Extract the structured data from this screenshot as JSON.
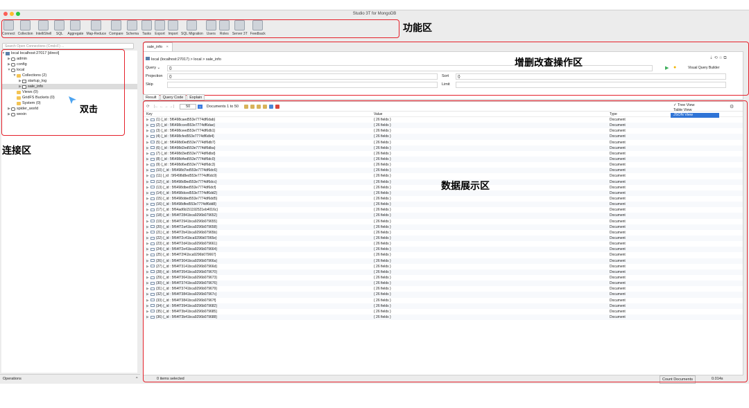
{
  "window": {
    "title": "Studio 3T for MongoDB"
  },
  "toolbar": {
    "items": [
      "Connect",
      "Collection",
      "IntelliShell",
      "SQL",
      "Aggregate",
      "Map-Reduce",
      "Compare",
      "Schema",
      "Tasks",
      "Export",
      "Import",
      "SQL Migration",
      "Users",
      "Roles",
      "Server 3T",
      "Feedback"
    ]
  },
  "annotations": {
    "toolbar": "功能区",
    "query": "增删改查操作区",
    "dblclick": "双击",
    "connection": "连接区",
    "data": "数据展示区"
  },
  "sidebar": {
    "search_placeholder": "Search Open Connections (Cmd+F) ...",
    "tree": [
      {
        "label": "local localhost:27017 [direct]",
        "indent": 0,
        "icon": "server-icon",
        "arrow": "▼"
      },
      {
        "label": "admin",
        "indent": 1,
        "icon": "database-icon",
        "arrow": "▶"
      },
      {
        "label": "config",
        "indent": 1,
        "icon": "database-icon",
        "arrow": "▶"
      },
      {
        "label": "local",
        "indent": 1,
        "icon": "database-icon",
        "arrow": "▼"
      },
      {
        "label": "Collections (2)",
        "indent": 2,
        "icon": "folder-icon",
        "arrow": "▼"
      },
      {
        "label": "startup_log",
        "indent": 3,
        "icon": "collection-icon",
        "arrow": "▶"
      },
      {
        "label": "sale_info",
        "indent": 3,
        "icon": "collection-icon",
        "arrow": "▶",
        "selected": true
      },
      {
        "label": "Views (0)",
        "indent": 2,
        "icon": "folder-icon",
        "arrow": ""
      },
      {
        "label": "GridFS Buckets (0)",
        "indent": 2,
        "icon": "folder-icon",
        "arrow": ""
      },
      {
        "label": "System (0)",
        "indent": 2,
        "icon": "folder-icon",
        "arrow": ""
      },
      {
        "label": "spider_world",
        "indent": 1,
        "icon": "database-icon",
        "arrow": "▶"
      },
      {
        "label": "wexin",
        "indent": 1,
        "icon": "database-icon",
        "arrow": "▶"
      }
    ],
    "operations_label": "Operations"
  },
  "editor": {
    "tab_label": "sale_info",
    "breadcrumb": "local (localhost:27017)  >  local  >  sale_info",
    "query_label": "Query",
    "query_value": "{}",
    "projection_label": "Projection",
    "projection_value": "{}",
    "sort_label": "Sort",
    "sort_value": "{}",
    "skip_label": "Skip",
    "limit_label": "Limit",
    "visual_query_builder": "Visual Query Builder"
  },
  "results": {
    "subtabs": [
      "Result",
      "Query Code",
      "Explain"
    ],
    "page_size": "50",
    "doc_range": "Documents 1 to 50",
    "columns": {
      "key": "Key",
      "value": "Value",
      "type": "Type"
    },
    "view_options": [
      "Tree View",
      "Table View",
      "JSON View"
    ],
    "rows": [
      {
        "key": "(1) {_id : 5f6498caed553e7774df6dab}",
        "value": "{ 26 fields }",
        "type": "Document"
      },
      {
        "key": "(2) {_id : 5f6498cced553e7774df6dae}",
        "value": "{ 26 fields }",
        "type": "Document"
      },
      {
        "key": "(3) {_id : 5f6498ceed553e7774df6db1}",
        "value": "{ 26 fields }",
        "type": "Document"
      },
      {
        "key": "(4) {_id : 5f6498cfed553e7774df6db4}",
        "value": "{ 26 fields }",
        "type": "Document"
      },
      {
        "key": "(5) {_id : 5f6498d0ed553e7774df6db7}",
        "value": "{ 26 fields }",
        "type": "Document"
      },
      {
        "key": "(6) {_id : 5f6498d2ed553e7774df6dba}",
        "value": "{ 26 fields }",
        "type": "Document"
      },
      {
        "key": "(7) {_id : 5f6498d3ed553e7774df6dbd}",
        "value": "{ 26 fields }",
        "type": "Document"
      },
      {
        "key": "(8) {_id : 5f6498d4ed553e7774df6dc0}",
        "value": "{ 26 fields }",
        "type": "Document"
      },
      {
        "key": "(9) {_id : 5f6498d6ed553e7774df6dc3}",
        "value": "{ 26 fields }",
        "type": "Document"
      },
      {
        "key": "(10) {_id : 5f6498d7ed553e7774df6dc6}",
        "value": "{ 26 fields }",
        "type": "Document"
      },
      {
        "key": "(11) {_id : 5f6498d8ed553e7774df6dc9}",
        "value": "{ 26 fields }",
        "type": "Document"
      },
      {
        "key": "(12) {_id : 5f6498d9ed553e7774df6dcc}",
        "value": "{ 26 fields }",
        "type": "Document"
      },
      {
        "key": "(13) {_id : 5f6498dbed553e7774df6dcf}",
        "value": "{ 26 fields }",
        "type": "Document"
      },
      {
        "key": "(14) {_id : 5f6498dced553e7774df6dd2}",
        "value": "{ 26 fields }",
        "type": "Document"
      },
      {
        "key": "(15) {_id : 5f6498dded553e7774df6dd5}",
        "value": "{ 26 fields }",
        "type": "Document"
      },
      {
        "key": "(16) {_id : 5f6498dfed553e7774df6dd8}",
        "value": "{ 26 fields }",
        "type": "Document"
      },
      {
        "key": "(17) {_id : 5f64ad6b151192521eb4016c}",
        "value": "{ 26 fields }",
        "type": "Document"
      },
      {
        "key": "(18) {_id : 5f64f72841bca9296b079652}",
        "value": "{ 26 fields }",
        "type": "Document"
      },
      {
        "key": "(19) {_id : 5f64f72941bca9296b079655}",
        "value": "{ 26 fields }",
        "type": "Document"
      },
      {
        "key": "(20) {_id : 5f64f72a41bca9296b079658}",
        "value": "{ 26 fields }",
        "type": "Document"
      },
      {
        "key": "(21) {_id : 5f64f72b41bca9296b07965b}",
        "value": "{ 26 fields }",
        "type": "Document"
      },
      {
        "key": "(22) {_id : 5f64f72c41bca9296b07965e}",
        "value": "{ 26 fields }",
        "type": "Document"
      },
      {
        "key": "(23) {_id : 5f64f72d41bca9296b079661}",
        "value": "{ 26 fields }",
        "type": "Document"
      },
      {
        "key": "(24) {_id : 5f64f72e41bca9296b079664}",
        "value": "{ 26 fields }",
        "type": "Document"
      },
      {
        "key": "(25) {_id : 5f64f72f41bca9296b079667}",
        "value": "{ 26 fields }",
        "type": "Document"
      },
      {
        "key": "(26) {_id : 5f64f73041bca9296b07966a}",
        "value": "{ 26 fields }",
        "type": "Document"
      },
      {
        "key": "(27) {_id : 5f64f73141bca9296b07966d}",
        "value": "{ 26 fields }",
        "type": "Document"
      },
      {
        "key": "(28) {_id : 5f64f73541bca9296b079670}",
        "value": "{ 26 fields }",
        "type": "Document"
      },
      {
        "key": "(29) {_id : 5f64f73641bca9296b079673}",
        "value": "{ 26 fields }",
        "type": "Document"
      },
      {
        "key": "(30) {_id : 5f64f73741bca9296b079676}",
        "value": "{ 26 fields }",
        "type": "Document"
      },
      {
        "key": "(31) {_id : 5f64f73741bca9296b079679}",
        "value": "{ 26 fields }",
        "type": "Document"
      },
      {
        "key": "(32) {_id : 5f64f73841bca9296b07967c}",
        "value": "{ 26 fields }",
        "type": "Document"
      },
      {
        "key": "(33) {_id : 5f64f73841bca9296b07967f}",
        "value": "{ 26 fields }",
        "type": "Document"
      },
      {
        "key": "(34) {_id : 5f64f73941bca9296b079682}",
        "value": "{ 26 fields }",
        "type": "Document"
      },
      {
        "key": "(35) {_id : 5f64f73b41bca9296b079685}",
        "value": "{ 26 fields }",
        "type": "Document"
      },
      {
        "key": "(36) {_id : 5f64f73b41bca9296b079688}",
        "value": "{ 26 fields }",
        "type": "Document"
      }
    ],
    "status_selected": "0 items selected",
    "count_documents": "Count Documents",
    "elapsed": "0.014s"
  }
}
